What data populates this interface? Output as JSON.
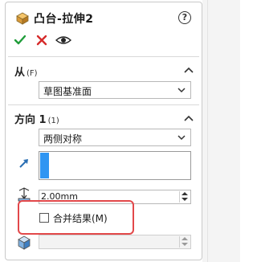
{
  "feature": {
    "title": "凸台-拉伸2",
    "help_label": "?"
  },
  "section_from": {
    "title": "从",
    "key": "(F)",
    "start_condition": "草图基准面"
  },
  "section_direction": {
    "title": "方向 1",
    "key": "(1)",
    "end_condition": "两侧对称",
    "depth_value": "2.00mm",
    "merge_result_label": "合并结果(M)",
    "merge_result_checked": false
  },
  "colors": {
    "accent_blue": "#2f95f2",
    "ok_green": "#1f9d3a",
    "cancel_red": "#d62b2b",
    "highlight_red": "#e2484a"
  },
  "icons": {
    "feature": "extrude-boss-icon",
    "help": "help-icon",
    "ok": "checkmark-icon",
    "cancel": "cancel-x-icon",
    "preview": "eye-icon",
    "reverse_direction": "direction-arrow-icon",
    "depth": "depth-icon",
    "draft": "draft-cube-icon"
  }
}
